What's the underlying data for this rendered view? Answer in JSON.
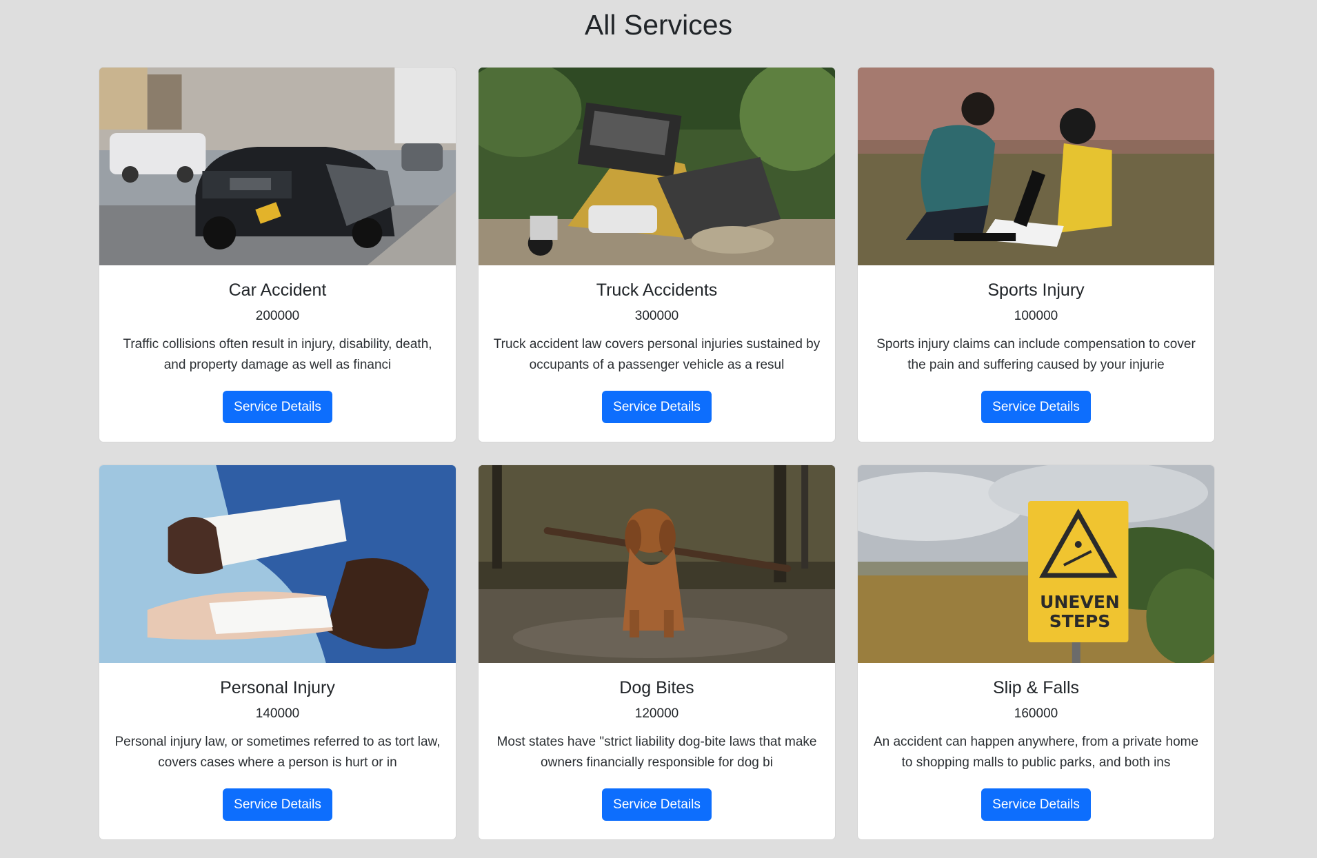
{
  "page": {
    "title": "All Services"
  },
  "services": [
    {
      "title": "Car Accident",
      "price": "200000",
      "description": "Traffic collisions often result in injury, disability, death, and property damage as well as financi",
      "button_label": "Service Details",
      "image": "car-accident-photo"
    },
    {
      "title": "Truck Accidents",
      "price": "300000",
      "description": "Truck accident law covers personal injuries sustained by occupants of a passenger vehicle as a resul",
      "button_label": "Service Details",
      "image": "truck-accident-photo"
    },
    {
      "title": "Sports Injury",
      "price": "100000",
      "description": "Sports injury claims can include compensation to cover the pain and suffering caused by your injurie",
      "button_label": "Service Details",
      "image": "sports-injury-photo"
    },
    {
      "title": "Personal Injury",
      "price": "140000",
      "description": "Personal injury law, or sometimes referred to as tort law, covers cases where a person is hurt or in",
      "button_label": "Service Details",
      "image": "bandaged-hand-photo"
    },
    {
      "title": "Dog Bites",
      "price": "120000",
      "description": "Most states have \"strict liability dog-bite laws that make owners financially responsible for dog bi",
      "button_label": "Service Details",
      "image": "dog-with-stick-photo"
    },
    {
      "title": "Slip & Falls",
      "price": "160000",
      "description": "An accident can happen anywhere, from a private home to shopping malls to public parks, and both ins",
      "button_label": "Service Details",
      "image": "uneven-steps-sign-photo",
      "sign_text": [
        "UNEVEN",
        "STEPS"
      ]
    }
  ],
  "colors": {
    "background": "#dedede",
    "card": "#ffffff",
    "button": "#0d6efd",
    "button_text": "#ffffff",
    "text": "#212529"
  }
}
